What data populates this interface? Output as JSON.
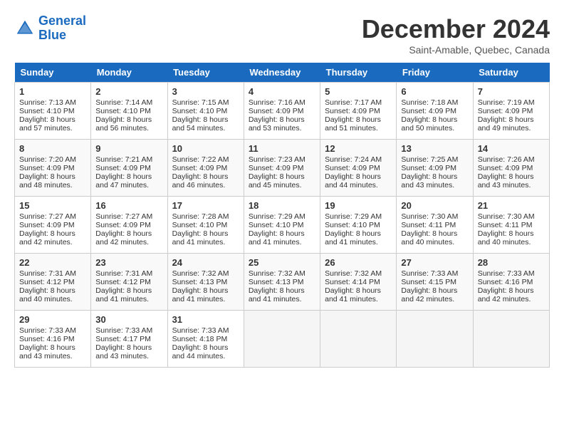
{
  "header": {
    "logo_line1": "General",
    "logo_line2": "Blue",
    "month": "December 2024",
    "location": "Saint-Amable, Quebec, Canada"
  },
  "weekdays": [
    "Sunday",
    "Monday",
    "Tuesday",
    "Wednesday",
    "Thursday",
    "Friday",
    "Saturday"
  ],
  "weeks": [
    [
      {
        "day": 1,
        "sunrise": "7:13 AM",
        "sunset": "4:10 PM",
        "daylight": "8 hours and 57 minutes."
      },
      {
        "day": 2,
        "sunrise": "7:14 AM",
        "sunset": "4:10 PM",
        "daylight": "8 hours and 56 minutes."
      },
      {
        "day": 3,
        "sunrise": "7:15 AM",
        "sunset": "4:10 PM",
        "daylight": "8 hours and 54 minutes."
      },
      {
        "day": 4,
        "sunrise": "7:16 AM",
        "sunset": "4:09 PM",
        "daylight": "8 hours and 53 minutes."
      },
      {
        "day": 5,
        "sunrise": "7:17 AM",
        "sunset": "4:09 PM",
        "daylight": "8 hours and 51 minutes."
      },
      {
        "day": 6,
        "sunrise": "7:18 AM",
        "sunset": "4:09 PM",
        "daylight": "8 hours and 50 minutes."
      },
      {
        "day": 7,
        "sunrise": "7:19 AM",
        "sunset": "4:09 PM",
        "daylight": "8 hours and 49 minutes."
      }
    ],
    [
      {
        "day": 8,
        "sunrise": "7:20 AM",
        "sunset": "4:09 PM",
        "daylight": "8 hours and 48 minutes."
      },
      {
        "day": 9,
        "sunrise": "7:21 AM",
        "sunset": "4:09 PM",
        "daylight": "8 hours and 47 minutes."
      },
      {
        "day": 10,
        "sunrise": "7:22 AM",
        "sunset": "4:09 PM",
        "daylight": "8 hours and 46 minutes."
      },
      {
        "day": 11,
        "sunrise": "7:23 AM",
        "sunset": "4:09 PM",
        "daylight": "8 hours and 45 minutes."
      },
      {
        "day": 12,
        "sunrise": "7:24 AM",
        "sunset": "4:09 PM",
        "daylight": "8 hours and 44 minutes."
      },
      {
        "day": 13,
        "sunrise": "7:25 AM",
        "sunset": "4:09 PM",
        "daylight": "8 hours and 43 minutes."
      },
      {
        "day": 14,
        "sunrise": "7:26 AM",
        "sunset": "4:09 PM",
        "daylight": "8 hours and 43 minutes."
      }
    ],
    [
      {
        "day": 15,
        "sunrise": "7:27 AM",
        "sunset": "4:09 PM",
        "daylight": "8 hours and 42 minutes."
      },
      {
        "day": 16,
        "sunrise": "7:27 AM",
        "sunset": "4:09 PM",
        "daylight": "8 hours and 42 minutes."
      },
      {
        "day": 17,
        "sunrise": "7:28 AM",
        "sunset": "4:10 PM",
        "daylight": "8 hours and 41 minutes."
      },
      {
        "day": 18,
        "sunrise": "7:29 AM",
        "sunset": "4:10 PM",
        "daylight": "8 hours and 41 minutes."
      },
      {
        "day": 19,
        "sunrise": "7:29 AM",
        "sunset": "4:10 PM",
        "daylight": "8 hours and 41 minutes."
      },
      {
        "day": 20,
        "sunrise": "7:30 AM",
        "sunset": "4:11 PM",
        "daylight": "8 hours and 40 minutes."
      },
      {
        "day": 21,
        "sunrise": "7:30 AM",
        "sunset": "4:11 PM",
        "daylight": "8 hours and 40 minutes."
      }
    ],
    [
      {
        "day": 22,
        "sunrise": "7:31 AM",
        "sunset": "4:12 PM",
        "daylight": "8 hours and 40 minutes."
      },
      {
        "day": 23,
        "sunrise": "7:31 AM",
        "sunset": "4:12 PM",
        "daylight": "8 hours and 41 minutes."
      },
      {
        "day": 24,
        "sunrise": "7:32 AM",
        "sunset": "4:13 PM",
        "daylight": "8 hours and 41 minutes."
      },
      {
        "day": 25,
        "sunrise": "7:32 AM",
        "sunset": "4:13 PM",
        "daylight": "8 hours and 41 minutes."
      },
      {
        "day": 26,
        "sunrise": "7:32 AM",
        "sunset": "4:14 PM",
        "daylight": "8 hours and 41 minutes."
      },
      {
        "day": 27,
        "sunrise": "7:33 AM",
        "sunset": "4:15 PM",
        "daylight": "8 hours and 42 minutes."
      },
      {
        "day": 28,
        "sunrise": "7:33 AM",
        "sunset": "4:16 PM",
        "daylight": "8 hours and 42 minutes."
      }
    ],
    [
      {
        "day": 29,
        "sunrise": "7:33 AM",
        "sunset": "4:16 PM",
        "daylight": "8 hours and 43 minutes."
      },
      {
        "day": 30,
        "sunrise": "7:33 AM",
        "sunset": "4:17 PM",
        "daylight": "8 hours and 43 minutes."
      },
      {
        "day": 31,
        "sunrise": "7:33 AM",
        "sunset": "4:18 PM",
        "daylight": "8 hours and 44 minutes."
      },
      null,
      null,
      null,
      null
    ]
  ]
}
